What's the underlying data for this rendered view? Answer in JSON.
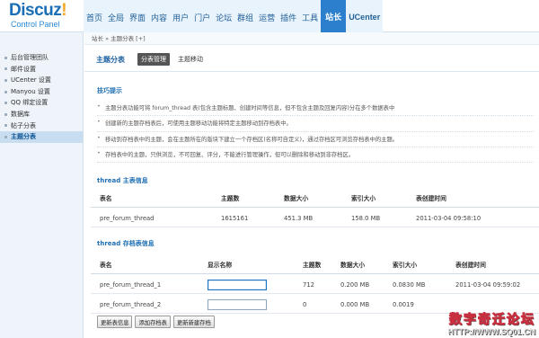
{
  "app": {
    "logo_text": "Discuz",
    "logo_bang": "!",
    "logo_sub": "Control Panel"
  },
  "topnav": {
    "items": [
      "首页",
      "全局",
      "界面",
      "内容",
      "用户",
      "门户",
      "论坛",
      "群组",
      "运营",
      "插件",
      "工具",
      "站长",
      "UCenter"
    ],
    "active_index": 11
  },
  "sidebar": {
    "items": [
      "后台管理团队",
      "邮件设置",
      "UCenter 设置",
      "Manyou 设置",
      "QQ 绑定设置",
      "数据库",
      "帖子分表",
      "主题分表"
    ],
    "active_index": 7
  },
  "breadcrumb": "站长 » 主题分表  [+]",
  "page": {
    "title": "主题分表",
    "tabs": [
      "分表管理",
      "主题移动"
    ],
    "active_tab": 0
  },
  "tips": {
    "title": "技巧提示",
    "items": [
      "主题分表功能可将 forum_thread 表(包含主题标题、创建时间等信息，但不包含主题及回复内容)分在多个数据表中",
      "创建新的主题存档表后，可使用主题移动功能将特定主题移动到存档表中。",
      "移动到存档表中的主题，会在主题所在的版块下建立一个存档区(名称可自定义)，通过存档区可浏览存档表中的主题。",
      "存档表中的主题，只供浏览，不可回复、评分，不能进行管理操作，但可以删除和移动到非存档区。"
    ]
  },
  "main_table": {
    "title": "thread 主表信息",
    "headers": [
      "表名",
      "主题数",
      "数据大小",
      "索引大小",
      "表创建时间"
    ],
    "rows": [
      [
        "pre_forum_thread",
        "1615161",
        "451.3 MB",
        "158.0 MB",
        "2011-03-04 09:58:10"
      ]
    ]
  },
  "archive_table": {
    "title": "thread 存档表信息",
    "headers": [
      "表名",
      "显示名称",
      "主题数",
      "数据大小",
      "索引大小",
      "表创建时间"
    ],
    "rows": [
      {
        "name": "pre_forum_thread_1",
        "display_name": "",
        "count": "712",
        "data": "0.200 MB",
        "index": "0.0830 MB",
        "created": "2011-03-04 09:59:02"
      },
      {
        "name": "pre_forum_thread_2",
        "display_name": "",
        "count": "0",
        "data": "0.000 MB",
        "index": "0.0019",
        "created": ""
      }
    ]
  },
  "buttons": [
    "更新表信息",
    "添加存档表",
    "更新新建存档"
  ],
  "watermark": {
    "title": "数字奇迁论坛",
    "url": "HTTP://WWW.SQ01.CN"
  }
}
